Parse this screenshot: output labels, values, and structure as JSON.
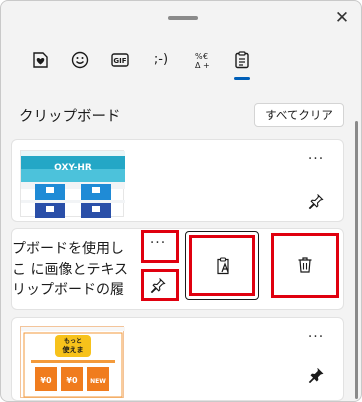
{
  "window": {
    "close_glyph": "✕"
  },
  "tabs": [
    {
      "name": "sticker",
      "icon": "heart-sticker-icon"
    },
    {
      "name": "emoji",
      "icon": "smiley-icon"
    },
    {
      "name": "gif",
      "label": "GIF",
      "icon": "gif-icon"
    },
    {
      "name": "kaomoji",
      "label": ";-)",
      "icon": "kaomoji-icon"
    },
    {
      "name": "symbols",
      "icon": "symbols-icon"
    },
    {
      "name": "clipboard",
      "icon": "clipboard-icon",
      "selected": true
    }
  ],
  "section": {
    "title": "クリップボード",
    "clear_all_label": "すべてクリア"
  },
  "items": [
    {
      "type": "image",
      "pinned": false,
      "more_glyph": "···"
    },
    {
      "type": "text",
      "pinned": false,
      "lines": [
        "プボードを使用し",
        "こ に画像とテキス",
        "リップボードの履"
      ],
      "more_glyph": "···"
    },
    {
      "type": "image",
      "pinned": true,
      "more_glyph": "···"
    }
  ],
  "image1": {
    "brand_text": "OXY-HR"
  },
  "image3": {
    "banner_line1": "もっと",
    "banner_line2": "使えま",
    "price_a": "¥0",
    "price_b": "¥0",
    "badge": "NEW"
  },
  "colors": {
    "accent": "#005fb8",
    "highlight_red": "#e0000f",
    "panel_bg": "#f3f3f3"
  }
}
